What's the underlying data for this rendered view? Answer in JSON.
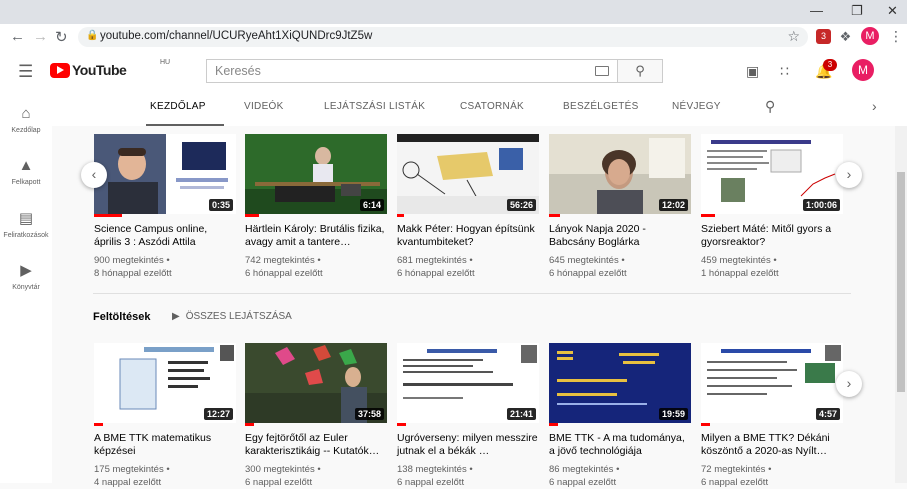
{
  "browser": {
    "url": "youtube.com/channel/UCURyeAht1XiQUNDrc9JtZ5w",
    "profile_initial": "M",
    "ext_badge": "3"
  },
  "header": {
    "logo_text": "YouTube",
    "country": "HU",
    "search_placeholder": "Keresés",
    "notif_count": "3",
    "avatar_initial": "M"
  },
  "sidebar": {
    "items": [
      {
        "label": "Kezdőlap",
        "icon": "home-icon"
      },
      {
        "label": "Felkapott",
        "icon": "fire-icon"
      },
      {
        "label": "Feliratkozások",
        "icon": "subscriptions-icon"
      },
      {
        "label": "Könyvtár",
        "icon": "library-icon"
      }
    ]
  },
  "tabs": [
    "KEZDŐLAP",
    "VIDEÓK",
    "LEJÁTSZÁSI LISTÁK",
    "CSATORNÁK",
    "BESZÉLGETÉS",
    "NÉVJEGY"
  ],
  "shelf": {
    "title": "Feltöltések",
    "play_all": "ÖSSZES LEJÁTSZÁSA"
  },
  "row1": [
    {
      "title": "Science Campus online, április 3 : Aszódi Attila",
      "views": "900 megtekintés •",
      "age": "8 hónappal ezelőtt",
      "duration": "0:35",
      "progress": 0.2
    },
    {
      "title": "Härtlein Károly: Brutális fizika, avagy amit a tantere…",
      "views": "742 megtekintés •",
      "age": "6 hónappal ezelőtt",
      "duration": "6:14",
      "progress": 0.1
    },
    {
      "title": "Makk Péter: Hogyan építsünk kvantumbiteket?",
      "views": "681 megtekintés •",
      "age": "6 hónappal ezelőtt",
      "duration": "56:26",
      "progress": 0.05
    },
    {
      "title": "Lányok Napja 2020 - Babcsány Boglárka",
      "views": "645 megtekintés •",
      "age": "6 hónappal ezelőtt",
      "duration": "12:02",
      "progress": 0.08
    },
    {
      "title": "Sziebert Máté: Mitől gyors a gyorsreaktor?",
      "views": "459 megtekintés •",
      "age": "1 hónappal ezelőtt",
      "duration": "1:00:06",
      "progress": 0.1
    }
  ],
  "row2": [
    {
      "title": "A BME TTK matematikus képzései",
      "views": "175 megtekintés •",
      "age": "4 nappal ezelőtt",
      "duration": "12:27",
      "progress": 0.06
    },
    {
      "title": "Egy fejtörőtől az Euler karakterisztikáig -- Kutatók…",
      "views": "300 megtekintés •",
      "age": "6 nappal ezelőtt",
      "duration": "37:58",
      "progress": 0.06
    },
    {
      "title": "Ugróverseny: milyen messzire jutnak el a békák …",
      "views": "138 megtekintés •",
      "age": "6 nappal ezelőtt",
      "duration": "21:41",
      "progress": 0.06
    },
    {
      "title": "BME TTK - A ma tudománya, a jövő technológiája",
      "views": "86 megtekintés •",
      "age": "6 nappal ezelőtt",
      "duration": "19:59",
      "progress": 0.06
    },
    {
      "title": "Milyen a BME TTK? Dékáni köszöntő a 2020-as Nyílt…",
      "views": "72 megtekintés •",
      "age": "6 nappal ezelőtt",
      "duration": "4:57",
      "progress": 0.06
    }
  ]
}
